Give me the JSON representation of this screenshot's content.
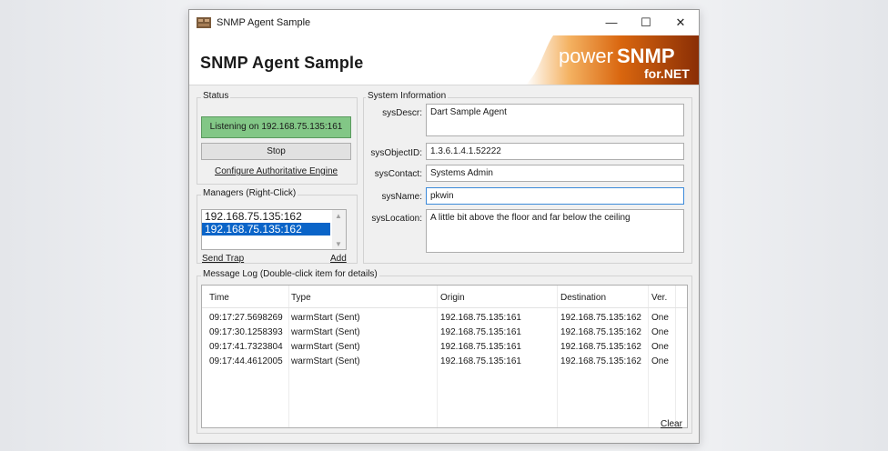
{
  "window": {
    "title": "SNMP Agent Sample",
    "minimize_glyph": "—",
    "maximize_glyph": "☐",
    "close_glyph": "✕"
  },
  "banner": {
    "title": "SNMP Agent Sample",
    "logo_power": "power",
    "logo_snmp": "SNMP",
    "logo_net": "for.NET"
  },
  "status": {
    "group_label": "Status",
    "message": "Listening on 192.168.75.135:161",
    "stop_label": "Stop",
    "configure_link": "Configure Authoritative Engine"
  },
  "managers": {
    "group_label": "Managers (Right-Click)",
    "items": [
      {
        "label": "192.168.75.135:162",
        "selected": false
      },
      {
        "label": "192.168.75.135:162",
        "selected": true
      }
    ],
    "send_trap_link": "Send Trap",
    "add_link": "Add"
  },
  "system_info": {
    "group_label": "System Information",
    "fields": {
      "sysDescr": {
        "label": "sysDescr:",
        "value": "Dart Sample Agent"
      },
      "sysObjectID": {
        "label": "sysObjectID:",
        "value": "1.3.6.1.4.1.52222"
      },
      "sysContact": {
        "label": "sysContact:",
        "value": "Systems Admin"
      },
      "sysName": {
        "label": "sysName:",
        "value": "pkwin"
      },
      "sysLocation": {
        "label": "sysLocation:",
        "value": "A little bit above the floor and far below the ceiling"
      }
    }
  },
  "message_log": {
    "group_label": "Message Log (Double-click item for details)",
    "columns": [
      "Time",
      "Type",
      "Origin",
      "Destination",
      "Ver."
    ],
    "rows": [
      [
        "09:17:27.5698269",
        "warmStart (Sent)",
        "192.168.75.135:161",
        "192.168.75.135:162",
        "One"
      ],
      [
        "09:17:30.1258393",
        "warmStart (Sent)",
        "192.168.75.135:161",
        "192.168.75.135:162",
        "One"
      ],
      [
        "09:17:41.7323804",
        "warmStart (Sent)",
        "192.168.75.135:161",
        "192.168.75.135:162",
        "One"
      ],
      [
        "09:17:44.4612005",
        "warmStart (Sent)",
        "192.168.75.135:161",
        "192.168.75.135:162",
        "One"
      ]
    ],
    "clear_link": "Clear"
  },
  "colors": {
    "status_green": "#82c786",
    "selection_blue": "#0a64c8",
    "logo_orange": "#e07a18"
  }
}
